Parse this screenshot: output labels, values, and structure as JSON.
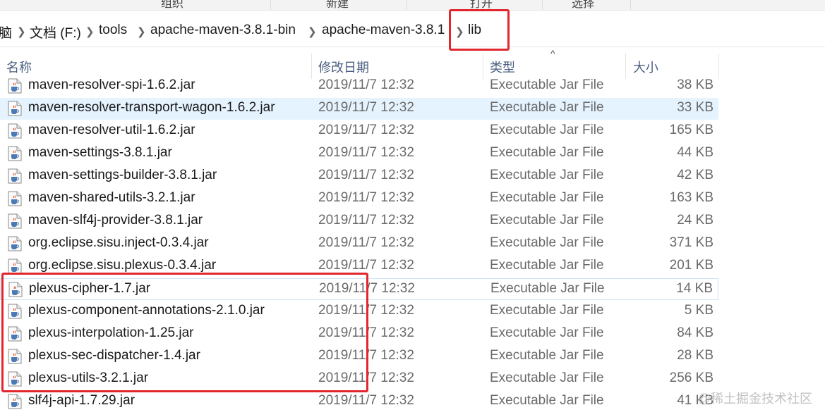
{
  "ribbon": {
    "groups": [
      "组织",
      "新建",
      "打开",
      "选择"
    ]
  },
  "breadcrumb": {
    "items": [
      "脑",
      "文档 (F:)",
      "tools",
      "apache-maven-3.8.1-bin",
      "apache-maven-3.8.1",
      "lib"
    ]
  },
  "columns": {
    "name": "名称",
    "date": "修改日期",
    "type": "类型",
    "size": "大小"
  },
  "files": [
    {
      "name": "maven-resolver-spi-1.6.2.jar",
      "date": "2019/11/7 12:32",
      "type": "Executable Jar File",
      "size": "38 KB"
    },
    {
      "name": "maven-resolver-transport-wagon-1.6.2.jar",
      "date": "2019/11/7 12:32",
      "type": "Executable Jar File",
      "size": "33 KB",
      "state": "hover"
    },
    {
      "name": "maven-resolver-util-1.6.2.jar",
      "date": "2019/11/7 12:32",
      "type": "Executable Jar File",
      "size": "165 KB"
    },
    {
      "name": "maven-settings-3.8.1.jar",
      "date": "2019/11/7 12:32",
      "type": "Executable Jar File",
      "size": "44 KB"
    },
    {
      "name": "maven-settings-builder-3.8.1.jar",
      "date": "2019/11/7 12:32",
      "type": "Executable Jar File",
      "size": "42 KB"
    },
    {
      "name": "maven-shared-utils-3.2.1.jar",
      "date": "2019/11/7 12:32",
      "type": "Executable Jar File",
      "size": "163 KB"
    },
    {
      "name": "maven-slf4j-provider-3.8.1.jar",
      "date": "2019/11/7 12:32",
      "type": "Executable Jar File",
      "size": "24 KB"
    },
    {
      "name": "org.eclipse.sisu.inject-0.3.4.jar",
      "date": "2019/11/7 12:32",
      "type": "Executable Jar File",
      "size": "371 KB"
    },
    {
      "name": "org.eclipse.sisu.plexus-0.3.4.jar",
      "date": "2019/11/7 12:32",
      "type": "Executable Jar File",
      "size": "201 KB"
    },
    {
      "name": "plexus-cipher-1.7.jar",
      "date": "2019/11/7 12:32",
      "type": "Executable Jar File",
      "size": "14 KB",
      "state": "focus"
    },
    {
      "name": "plexus-component-annotations-2.1.0.jar",
      "date": "2019/11/7 12:32",
      "type": "Executable Jar File",
      "size": "5 KB"
    },
    {
      "name": "plexus-interpolation-1.25.jar",
      "date": "2019/11/7 12:32",
      "type": "Executable Jar File",
      "size": "84 KB"
    },
    {
      "name": "plexus-sec-dispatcher-1.4.jar",
      "date": "2019/11/7 12:32",
      "type": "Executable Jar File",
      "size": "28 KB"
    },
    {
      "name": "plexus-utils-3.2.1.jar",
      "date": "2019/11/7 12:32",
      "type": "Executable Jar File",
      "size": "256 KB"
    },
    {
      "name": "slf4j-api-1.7.29.jar",
      "date": "2019/11/7 12:32",
      "type": "Executable Jar File",
      "size": "41 KB"
    }
  ],
  "file_icon": "java-jar-icon",
  "sort_indicator": "^",
  "watermark": "@稀土掘金技术社区",
  "colors": {
    "highlight": "#e1262d",
    "hover_row": "#e5f3ff",
    "header_text": "#4d6082"
  }
}
